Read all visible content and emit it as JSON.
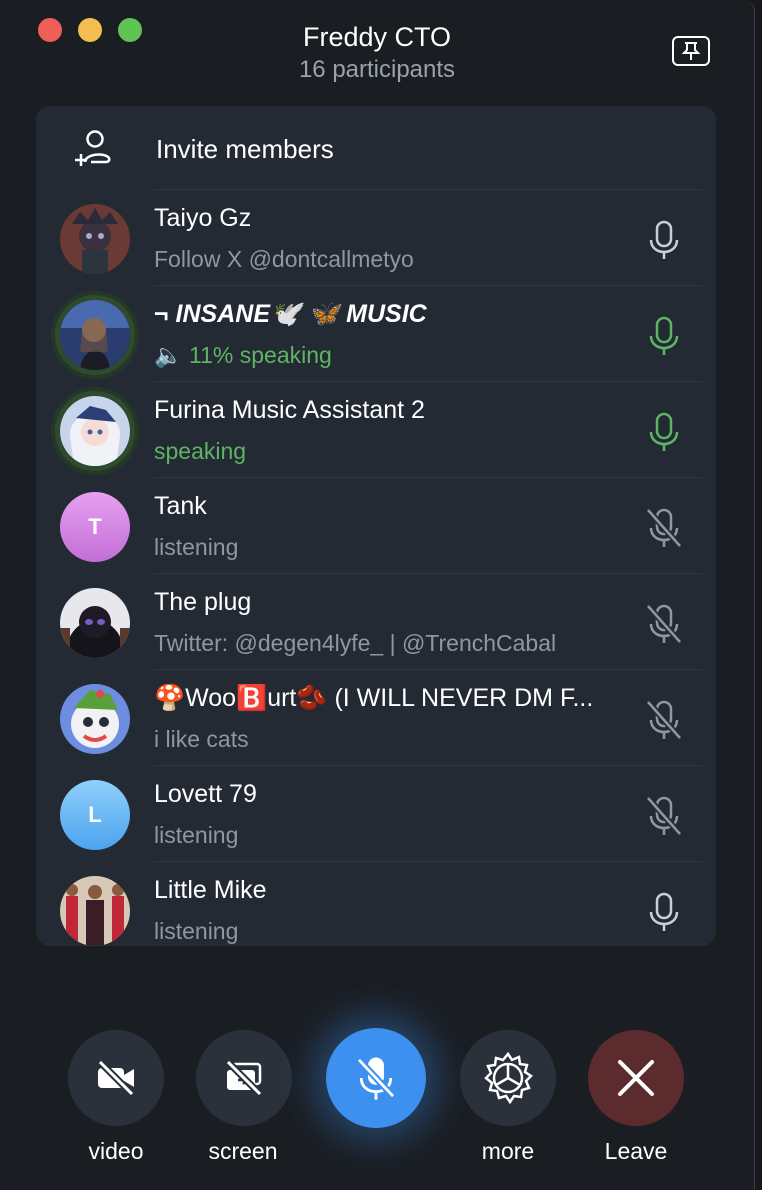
{
  "window": {
    "title": "Freddy CTO",
    "subtitle": "16 participants"
  },
  "invite": {
    "label": "Invite members"
  },
  "participants": [
    {
      "name": "Taiyo Gz",
      "status": "Follow X @dontcallmetyo",
      "mic": "on"
    },
    {
      "name": "¬ INSANE🕊️ 🦋 MUSIC",
      "status": "🔈 11% speaking",
      "mic": "speaking"
    },
    {
      "name": "Furina Music Assistant 2",
      "status": "speaking",
      "mic": "speaking"
    },
    {
      "name": "Tank",
      "status": "listening",
      "mic": "muted",
      "initial": "T"
    },
    {
      "name": "The plug",
      "status": "Twitter: @degen4lyfe_ | @TrenchCabal",
      "mic": "muted"
    },
    {
      "name": "🍄Woo🅱️urt🫘 (I WILL NEVER DM F...",
      "status": "i like cats",
      "mic": "muted"
    },
    {
      "name": "Lovett 79",
      "status": "listening",
      "mic": "muted",
      "initial": "L"
    },
    {
      "name": "Little Mike",
      "status": "listening",
      "mic": "on"
    }
  ],
  "controls": {
    "video": "video",
    "screen": "screen",
    "more": "more",
    "leave": "Leave"
  },
  "colors": {
    "speaking": "#5db561",
    "accent": "#3d8ff0",
    "leave": "#5c2b2e",
    "panel": "#232a34"
  }
}
